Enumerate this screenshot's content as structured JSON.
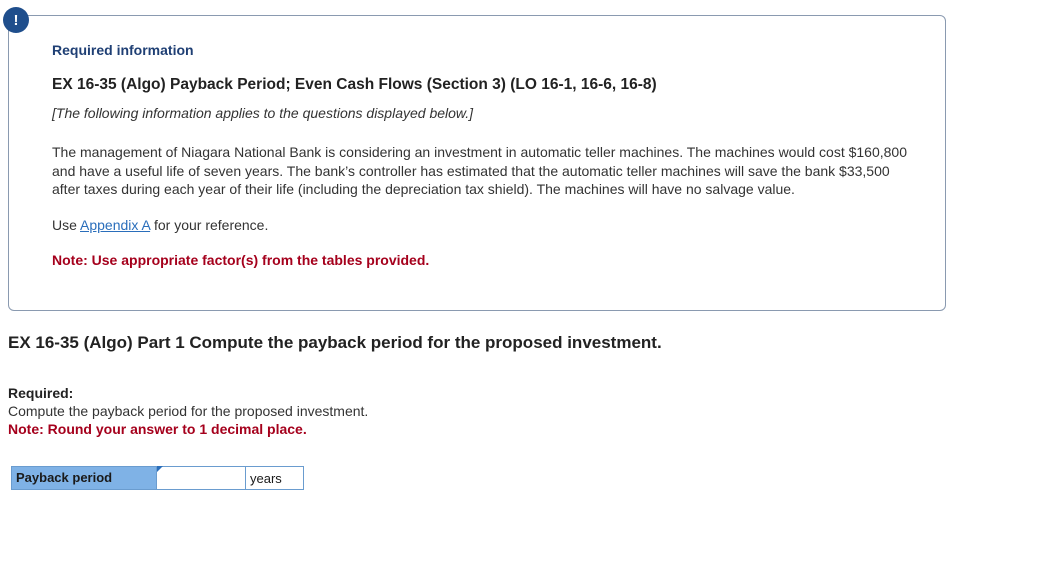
{
  "alert": {
    "symbol": "!",
    "icon": "alert-icon",
    "color": "#1f4e8c"
  },
  "info": {
    "heading": "Required information",
    "exercise_title": "EX 16-35 (Algo) Payback Period; Even Cash Flows (Section 3) (LO 16-1, 16-6, 16-8)",
    "applies_note": "[The following information applies to the questions displayed below.]",
    "paragraph": "The management of Niagara National Bank is considering an investment in automatic teller machines. The machines would cost $160,800 and have a useful life of seven years. The bank’s controller has estimated that the automatic teller machines will save the bank $33,500 after taxes during each year of their life (including the depreciation tax shield). The machines will have no salvage value.",
    "use_prefix": "Use ",
    "appendix_link": "Appendix A",
    "use_suffix": " for your reference.",
    "note": "Note: Use appropriate factor(s) from the tables provided."
  },
  "part": {
    "title": "EX 16-35 (Algo) Part 1 Compute the payback period for the proposed investment."
  },
  "required": {
    "label": "Required:",
    "text": "Compute the payback period for the proposed investment.",
    "note": "Note: Round your answer to 1 decimal place."
  },
  "answer": {
    "label": "Payback period",
    "value": "",
    "unit": "years"
  },
  "colors": {
    "accent": "#1f4e8c",
    "note_red": "#a5001c",
    "label_bg": "#7fb2e6",
    "link": "#2a6ebb"
  }
}
